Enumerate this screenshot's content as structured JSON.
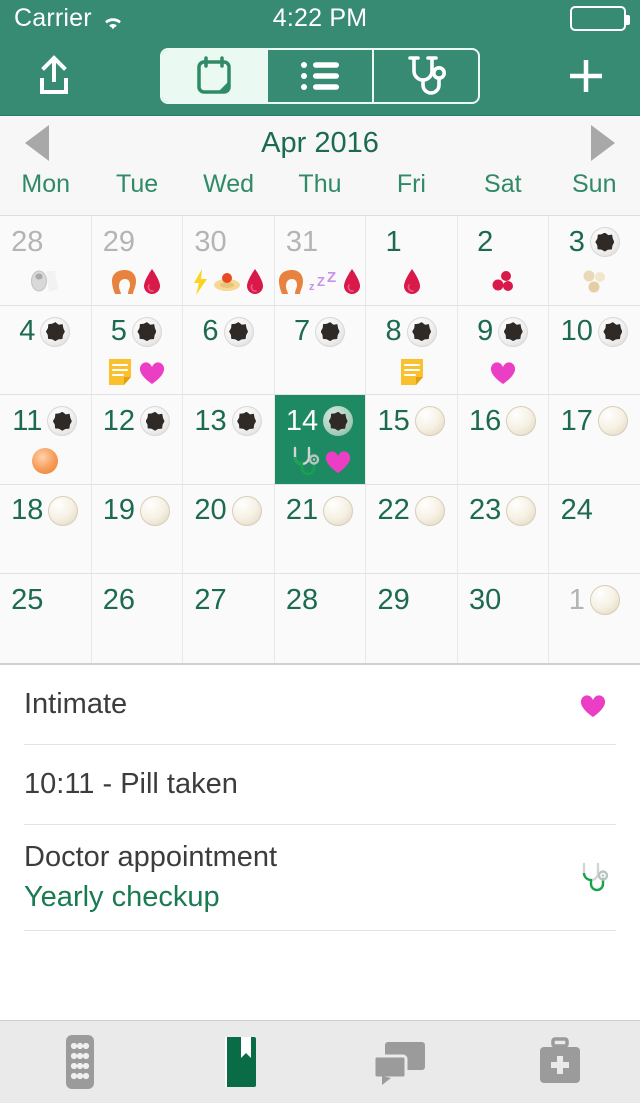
{
  "status_bar": {
    "carrier": "Carrier",
    "wifi_icon": "wifi-icon",
    "time": "4:22 PM",
    "battery_icon": "battery-full-icon"
  },
  "nav_bar": {
    "share_button": "share-icon",
    "add_button": "plus-icon",
    "segments": [
      {
        "name": "calendar",
        "icon": "calendar-icon",
        "active": true
      },
      {
        "name": "list",
        "icon": "list-icon",
        "active": false
      },
      {
        "name": "doctor",
        "icon": "stethoscope-icon",
        "active": false
      }
    ]
  },
  "calendar": {
    "prev_label": "prev-month-arrow",
    "next_label": "next-month-arrow",
    "title": "Apr 2016",
    "day_names": [
      "Mon",
      "Tue",
      "Wed",
      "Thu",
      "Fri",
      "Sat",
      "Sun"
    ],
    "weeks": [
      [
        {
          "day": "28",
          "muted": true,
          "selected": false,
          "pill": "none",
          "marks": [
            "toilet-paper"
          ]
        },
        {
          "day": "29",
          "muted": true,
          "selected": false,
          "pill": "none",
          "marks": [
            "hair",
            "blood-drop"
          ]
        },
        {
          "day": "30",
          "muted": true,
          "selected": false,
          "pill": "none",
          "marks": [
            "bolt",
            "ring",
            "blood-drop"
          ]
        },
        {
          "day": "31",
          "muted": true,
          "selected": false,
          "pill": "none",
          "marks": [
            "hair",
            "zzz",
            "blood-drop"
          ]
        },
        {
          "day": "1",
          "muted": false,
          "selected": false,
          "pill": "none",
          "marks": [
            "blood-drop"
          ]
        },
        {
          "day": "2",
          "muted": false,
          "selected": false,
          "pill": "none",
          "marks": [
            "berries"
          ]
        },
        {
          "day": "3",
          "muted": false,
          "selected": false,
          "pill": "active",
          "marks": [
            "pills-three"
          ]
        }
      ],
      [
        {
          "day": "4",
          "muted": false,
          "selected": false,
          "pill": "active",
          "marks": []
        },
        {
          "day": "5",
          "muted": false,
          "selected": false,
          "pill": "active",
          "marks": [
            "note",
            "heart"
          ]
        },
        {
          "day": "6",
          "muted": false,
          "selected": false,
          "pill": "active",
          "marks": []
        },
        {
          "day": "7",
          "muted": false,
          "selected": false,
          "pill": "active",
          "marks": []
        },
        {
          "day": "8",
          "muted": false,
          "selected": false,
          "pill": "active",
          "marks": [
            "note"
          ]
        },
        {
          "day": "9",
          "muted": false,
          "selected": false,
          "pill": "active",
          "marks": [
            "heart"
          ]
        },
        {
          "day": "10",
          "muted": false,
          "selected": false,
          "pill": "active",
          "marks": []
        }
      ],
      [
        {
          "day": "11",
          "muted": false,
          "selected": false,
          "pill": "active",
          "marks": [
            "ovulation"
          ]
        },
        {
          "day": "12",
          "muted": false,
          "selected": false,
          "pill": "active",
          "marks": []
        },
        {
          "day": "13",
          "muted": false,
          "selected": false,
          "pill": "active",
          "marks": []
        },
        {
          "day": "14",
          "muted": false,
          "selected": true,
          "pill": "active",
          "marks": [
            "stethoscope",
            "heart"
          ]
        },
        {
          "day": "15",
          "muted": false,
          "selected": false,
          "pill": "placebo",
          "marks": []
        },
        {
          "day": "16",
          "muted": false,
          "selected": false,
          "pill": "placebo",
          "marks": []
        },
        {
          "day": "17",
          "muted": false,
          "selected": false,
          "pill": "placebo",
          "marks": []
        }
      ],
      [
        {
          "day": "18",
          "muted": false,
          "selected": false,
          "pill": "placebo",
          "marks": []
        },
        {
          "day": "19",
          "muted": false,
          "selected": false,
          "pill": "placebo",
          "marks": []
        },
        {
          "day": "20",
          "muted": false,
          "selected": false,
          "pill": "placebo",
          "marks": []
        },
        {
          "day": "21",
          "muted": false,
          "selected": false,
          "pill": "placebo",
          "marks": []
        },
        {
          "day": "22",
          "muted": false,
          "selected": false,
          "pill": "placebo",
          "marks": []
        },
        {
          "day": "23",
          "muted": false,
          "selected": false,
          "pill": "placebo",
          "marks": []
        },
        {
          "day": "24",
          "muted": false,
          "selected": false,
          "pill": "none",
          "marks": []
        }
      ],
      [
        {
          "day": "25",
          "muted": false,
          "selected": false,
          "pill": "none",
          "marks": []
        },
        {
          "day": "26",
          "muted": false,
          "selected": false,
          "pill": "none",
          "marks": []
        },
        {
          "day": "27",
          "muted": false,
          "selected": false,
          "pill": "none",
          "marks": []
        },
        {
          "day": "28",
          "muted": false,
          "selected": false,
          "pill": "none",
          "marks": []
        },
        {
          "day": "29",
          "muted": false,
          "selected": false,
          "pill": "none",
          "marks": []
        },
        {
          "day": "30",
          "muted": false,
          "selected": false,
          "pill": "none",
          "marks": []
        },
        {
          "day": "1",
          "muted": true,
          "selected": false,
          "pill": "placebo",
          "marks": []
        }
      ]
    ]
  },
  "detail_list": [
    {
      "title": "Intimate",
      "subtitle": "",
      "icon": "heart"
    },
    {
      "title": "10:11 - Pill taken",
      "subtitle": "",
      "icon": "none"
    },
    {
      "title": "Doctor appointment",
      "subtitle": "Yearly checkup",
      "icon": "stethoscope"
    }
  ],
  "tab_bar": [
    {
      "name": "pills-tab",
      "icon": "pill-blister-icon",
      "active": false
    },
    {
      "name": "diary-tab",
      "icon": "book-icon",
      "active": true
    },
    {
      "name": "chat-tab",
      "icon": "chat-bubbles-icon",
      "active": false
    },
    {
      "name": "medkit-tab",
      "icon": "medical-bag-icon",
      "active": false
    }
  ],
  "colors": {
    "header_green": "#378B72",
    "selected_green": "#1D8A63",
    "text_green": "#1d6b4f",
    "heart_pink": "#EC3EC4",
    "blood_red": "#D8194A",
    "note_yellow": "#FBC02D",
    "ovulation_orange": "#F07F34"
  }
}
